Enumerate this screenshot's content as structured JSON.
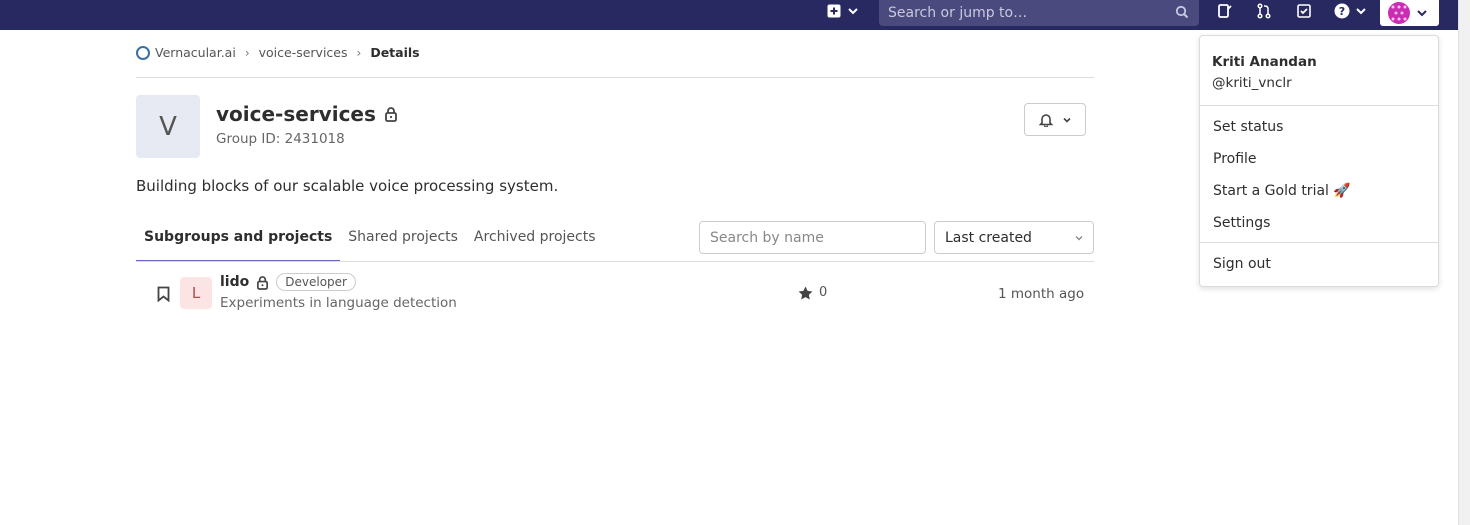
{
  "navbar": {
    "search_placeholder": "Search or jump to…",
    "icons": [
      "plus-square-icon",
      "search-icon",
      "issues-icon",
      "merge-request-icon",
      "todo-icon",
      "help-icon",
      "avatar-icon"
    ]
  },
  "breadcrumb": {
    "org": "Vernacular.ai",
    "group": "voice-services",
    "current": "Details"
  },
  "group": {
    "avatar_letter": "V",
    "name": "voice-services",
    "id_text": "Group ID: 2431018",
    "description": "Building blocks of our scalable voice processing system."
  },
  "tabs": [
    {
      "label": "Subgroups and projects",
      "active": true
    },
    {
      "label": "Shared projects",
      "active": false
    },
    {
      "label": "Archived projects",
      "active": false
    }
  ],
  "filter": {
    "search_placeholder": "Search by name",
    "sort_value": "Last created"
  },
  "projects": [
    {
      "avatar_letter": "L",
      "name": "lido",
      "role": "Developer",
      "description": "Experiments in language detection",
      "stars": "0",
      "updated": "1 month ago"
    }
  ],
  "user_menu": {
    "name": "Kriti Anandan",
    "handle": "@kriti_vnclr",
    "items": [
      "Set status",
      "Profile",
      "Start a Gold trial 🚀",
      "Settings"
    ],
    "sign_out": "Sign out"
  },
  "colors": {
    "navbar": "#292961",
    "tab_underline": "#6666c4",
    "avatar": "#ca2cb4"
  }
}
